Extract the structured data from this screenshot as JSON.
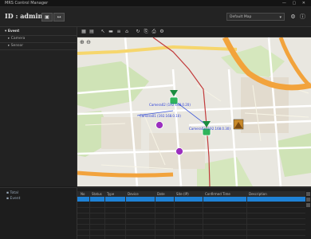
{
  "window": {
    "title": "MRS Control Manager",
    "controls": "— ▢ ✕"
  },
  "header": {
    "id_label": "ID : admin",
    "btn1": "▣",
    "btn2": "↔",
    "select_value": "Default Map",
    "select_arrow": "▾"
  },
  "left_tree": {
    "root": "Event",
    "items": [
      "Camera",
      "Sensor"
    ]
  },
  "toolbar": {
    "icons": [
      "grid-icon",
      "layout-icon",
      "pointer-icon",
      "ruler-icon",
      "layers-icon",
      "home-icon",
      "refresh-icon",
      "export-icon",
      "print-icon",
      "settings-icon"
    ]
  },
  "map": {
    "zoom": "⊕ ⊖",
    "labels": [
      "Camera02 (192.168.0.20)",
      "Camera01 (192.168.0.10)",
      "Camera03 (192.168.0.30)"
    ]
  },
  "bottom_left": {
    "items": [
      "Total",
      "Event"
    ]
  },
  "grid": {
    "columns": [
      "No",
      "Status",
      "Type",
      "Device",
      "Date",
      "Site (IP)",
      "Confirmed Time",
      "Description"
    ]
  },
  "colors": {
    "accent": "#1e82d6",
    "camera_green": "#22a34a",
    "poi_purple": "#9b2fbf",
    "route_red": "#c23b3b",
    "highway_orange": "#f2a33c"
  }
}
